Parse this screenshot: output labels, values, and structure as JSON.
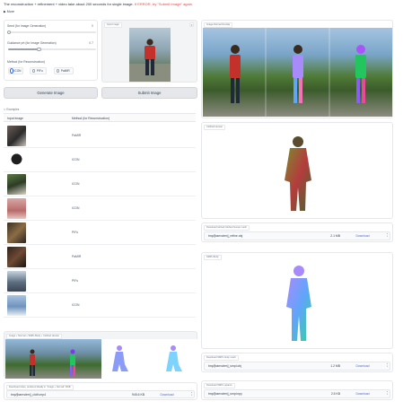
{
  "header": {
    "notice_prefix": "The reconstruction + refinement + video take about 200 seconds for single image.",
    "notice_error": "If ERROR, try \"Submit Image\" again.",
    "more_label": "▶ More"
  },
  "controls": {
    "seed_label": "Seed (for Image Generation)",
    "seed_value": "0",
    "seed_fraction": 0.0,
    "guidance_label": "Guidance prt (for Image Generation)",
    "guidance_value": "0.7",
    "guidance_fraction": 0.35,
    "method_label": "Method (for Reconstruction)",
    "methods": [
      "ICON",
      "PIFu",
      "PaMIR"
    ],
    "selected_method": "ICON"
  },
  "buttons": {
    "generate": "Generate Image",
    "submit": "Submit Image"
  },
  "input_image": {
    "label": "Input Image"
  },
  "examples": {
    "label": "▽ Examples",
    "headers": [
      "Input Image",
      "Method (for Reconstruction)"
    ],
    "rows": [
      {
        "method": "PaMIR"
      },
      {
        "method": "ICON"
      },
      {
        "method": "ICON"
      },
      {
        "method": "ICON"
      },
      {
        "method": "PIFu"
      },
      {
        "method": "PaMIR"
      },
      {
        "method": "PIFu"
      },
      {
        "method": "ICON"
      }
    ]
  },
  "outputs": {
    "image_normal_overlap_label": "Image-Normal Overlap",
    "clothed_human_label": "Clothed Human",
    "refined_download_label": "Download refined clothed human mesh",
    "refined_file": {
      "name": "tmp/[barnsiem]_refine.obj",
      "size": "2.1 MB",
      "action": "Download"
    },
    "smpl_body_label": "SMPL Body",
    "smpl_mesh_label": "Download SMPL body mesh",
    "smpl_mesh_file": {
      "name": "tmp/[barnsiem]_smpl.obj",
      "size": "1.2 MB",
      "action": "Download"
    },
    "smpl_params_label": "Download SMPL params",
    "smpl_params_file": {
      "name": "tmp/[barnsiem]_smpl.npy",
      "size": "2.5 KB",
      "action": "Download"
    },
    "video_label": "Image + Normal + SMPL Body + Clothed Human",
    "video_download_label": "Download video, rendered ideally in \"Image + Normal\" RGB",
    "video_file": {
      "name": "tmp/[barnsiem]_cloth.mp4",
      "size": "945.6 KB",
      "action": "Download"
    }
  },
  "colors": {
    "error_red": "#ef4444",
    "download_blue": "#4f6bd9",
    "accent_blue": "#2563eb"
  }
}
